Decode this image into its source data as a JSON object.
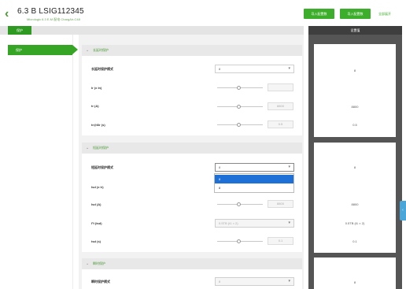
{
  "header": {
    "title": "6.3 B LSIG112345",
    "subtitle": "Micrologic 6.3 E-M  配电  ChargAir-C48",
    "buttons": [
      "导入配置数",
      "导入配置数"
    ],
    "link": "全部展开"
  },
  "tabs": [
    "保护"
  ],
  "right_panel": {
    "title": "设置值",
    "values": [
      "8",
      "8800",
      "0.5",
      "8",
      "8800",
      "0.5TB (t1 × 2)",
      "0.1",
      "8"
    ]
  },
  "sidebar": {
    "items": [
      "保护"
    ]
  },
  "sections": [
    {
      "title": "长延时保护",
      "rows": [
        {
          "label": "长延时保护模式",
          "type": "select",
          "value": "8"
        },
        {
          "label": "Ir (x In)",
          "type": "slider",
          "value": ""
        },
        {
          "label": "tr (A)",
          "type": "slider",
          "value": "8800"
        },
        {
          "label": "tr@6Ir (s)",
          "type": "slider",
          "value": "0.5"
        }
      ]
    },
    {
      "title": "短延时保护",
      "rows": [
        {
          "label": "短延时保护模式",
          "type": "select",
          "value": "8"
        },
        {
          "label": "Isd (x Ir)",
          "type": "slider",
          "value": ""
        },
        {
          "label": "Isd (A)",
          "type": "slider",
          "value": "8800"
        },
        {
          "label": "I²t (tsd)",
          "type": "select",
          "value": "0.5TB (t1 × 2)"
        },
        {
          "label": "tsd (s)",
          "type": "slider",
          "value": "0.1"
        }
      ],
      "dropdown_options": [
        "8",
        "8"
      ]
    },
    {
      "title": "瞬时保护",
      "rows": [
        {
          "label": "瞬时保护模式",
          "type": "select",
          "value": "8"
        }
      ]
    }
  ],
  "colors": {
    "accent": "#3dae2b",
    "sidebar_active": "#36a525",
    "select_highlight": "#1e6fd6"
  }
}
